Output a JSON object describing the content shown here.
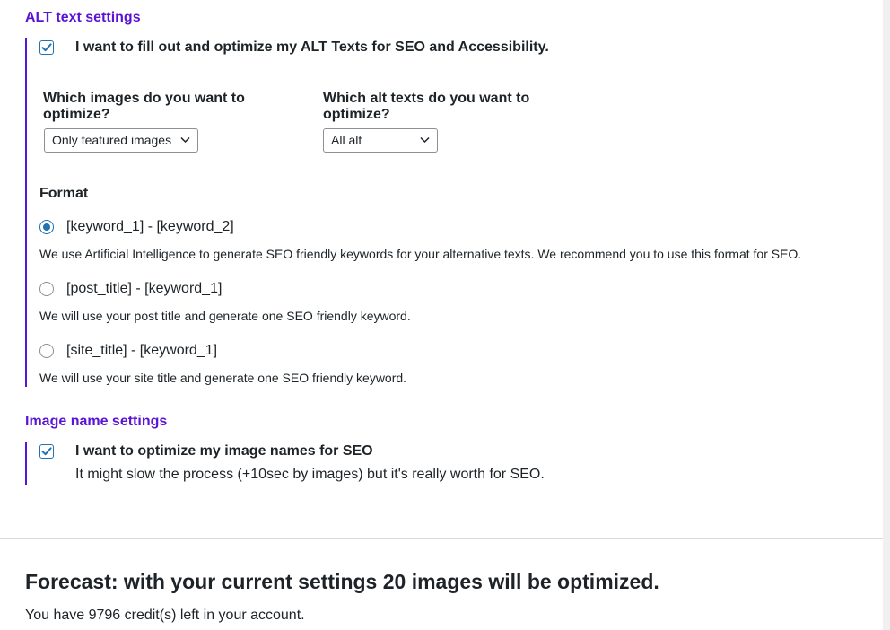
{
  "alt_section": {
    "title": "ALT text settings",
    "optimize_checkbox": {
      "checked": true,
      "label": "I want to fill out and optimize my ALT Texts for SEO and Accessibility."
    },
    "images_question": "Which images do you want to optimize?",
    "images_select_value": "Only featured images",
    "alt_question": "Which alt texts do you want to optimize?",
    "alt_select_value": "All alt",
    "format_heading": "Format",
    "format_options": [
      {
        "label": "[keyword_1] - [keyword_2]",
        "checked": true,
        "description": "We use Artificial Intelligence to generate SEO friendly keywords for your alternative texts. We recommend you to use this format for SEO."
      },
      {
        "label": "[post_title] - [keyword_1]",
        "checked": false,
        "description": "We will use your post title and generate one SEO friendly keyword."
      },
      {
        "label": "[site_title] - [keyword_1]",
        "checked": false,
        "description": "We will use your site title and generate one SEO friendly keyword."
      }
    ]
  },
  "image_name_section": {
    "title": "Image name settings",
    "optimize_checkbox": {
      "checked": true,
      "label": "I want to optimize my image names for SEO",
      "sublabel": "It might slow the process (+10sec by images) but it's really worth for SEO."
    }
  },
  "forecast": {
    "headline": "Forecast: with your current settings 20 images will be optimized.",
    "credits_text": "You have 9796 credit(s) left in your account."
  },
  "colors": {
    "accent": "#5b13d6",
    "control_blue": "#2271b1",
    "text": "#1d2327",
    "page_bg": "#f0f0f1"
  },
  "icons": {
    "checkbox_check": "check-icon",
    "select_arrow": "chevron-down-icon"
  }
}
